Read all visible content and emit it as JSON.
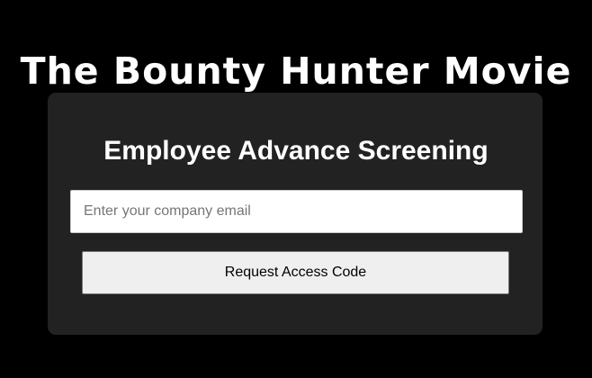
{
  "page": {
    "title": "The Bounty Hunter Movie"
  },
  "form": {
    "heading": "Employee Advance Screening",
    "email_placeholder": "Enter your company email",
    "email_value": "",
    "submit_label": "Request Access Code"
  },
  "colors": {
    "background": "#000000",
    "card": "#222222",
    "title_text": "#ffffff",
    "button_bg": "#efefef"
  }
}
